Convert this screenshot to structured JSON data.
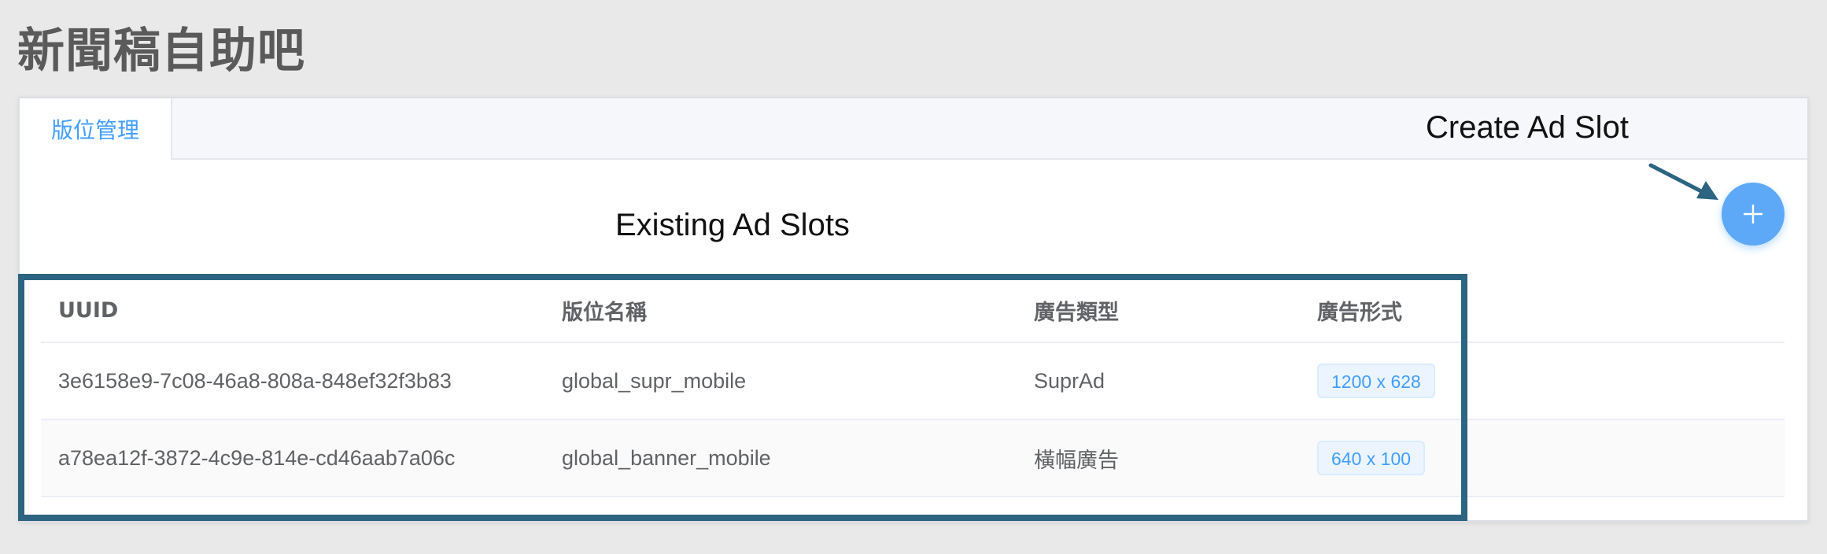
{
  "app": {
    "title": "新聞稿自助吧"
  },
  "tabs": [
    {
      "label": "版位管理",
      "active": true
    }
  ],
  "annotations": {
    "create": "Create Ad Slot",
    "existing": "Existing Ad Slots",
    "highlight_color": "#2c6481"
  },
  "add_button": {
    "icon": "plus-icon",
    "color": "#5ea8f8"
  },
  "table": {
    "headers": {
      "uuid": "UUID",
      "name": "版位名稱",
      "type": "廣告類型",
      "format": "廣告形式"
    },
    "rows": [
      {
        "uuid": "3e6158e9-7c08-46a8-808a-848ef32f3b83",
        "name": "global_supr_mobile",
        "type": "SuprAd",
        "format": "1200 x 628"
      },
      {
        "uuid": "a78ea12f-3872-4c9e-814e-cd46aab7a06c",
        "name": "global_banner_mobile",
        "type": "橫幅廣告",
        "format": "640 x 100"
      }
    ]
  }
}
